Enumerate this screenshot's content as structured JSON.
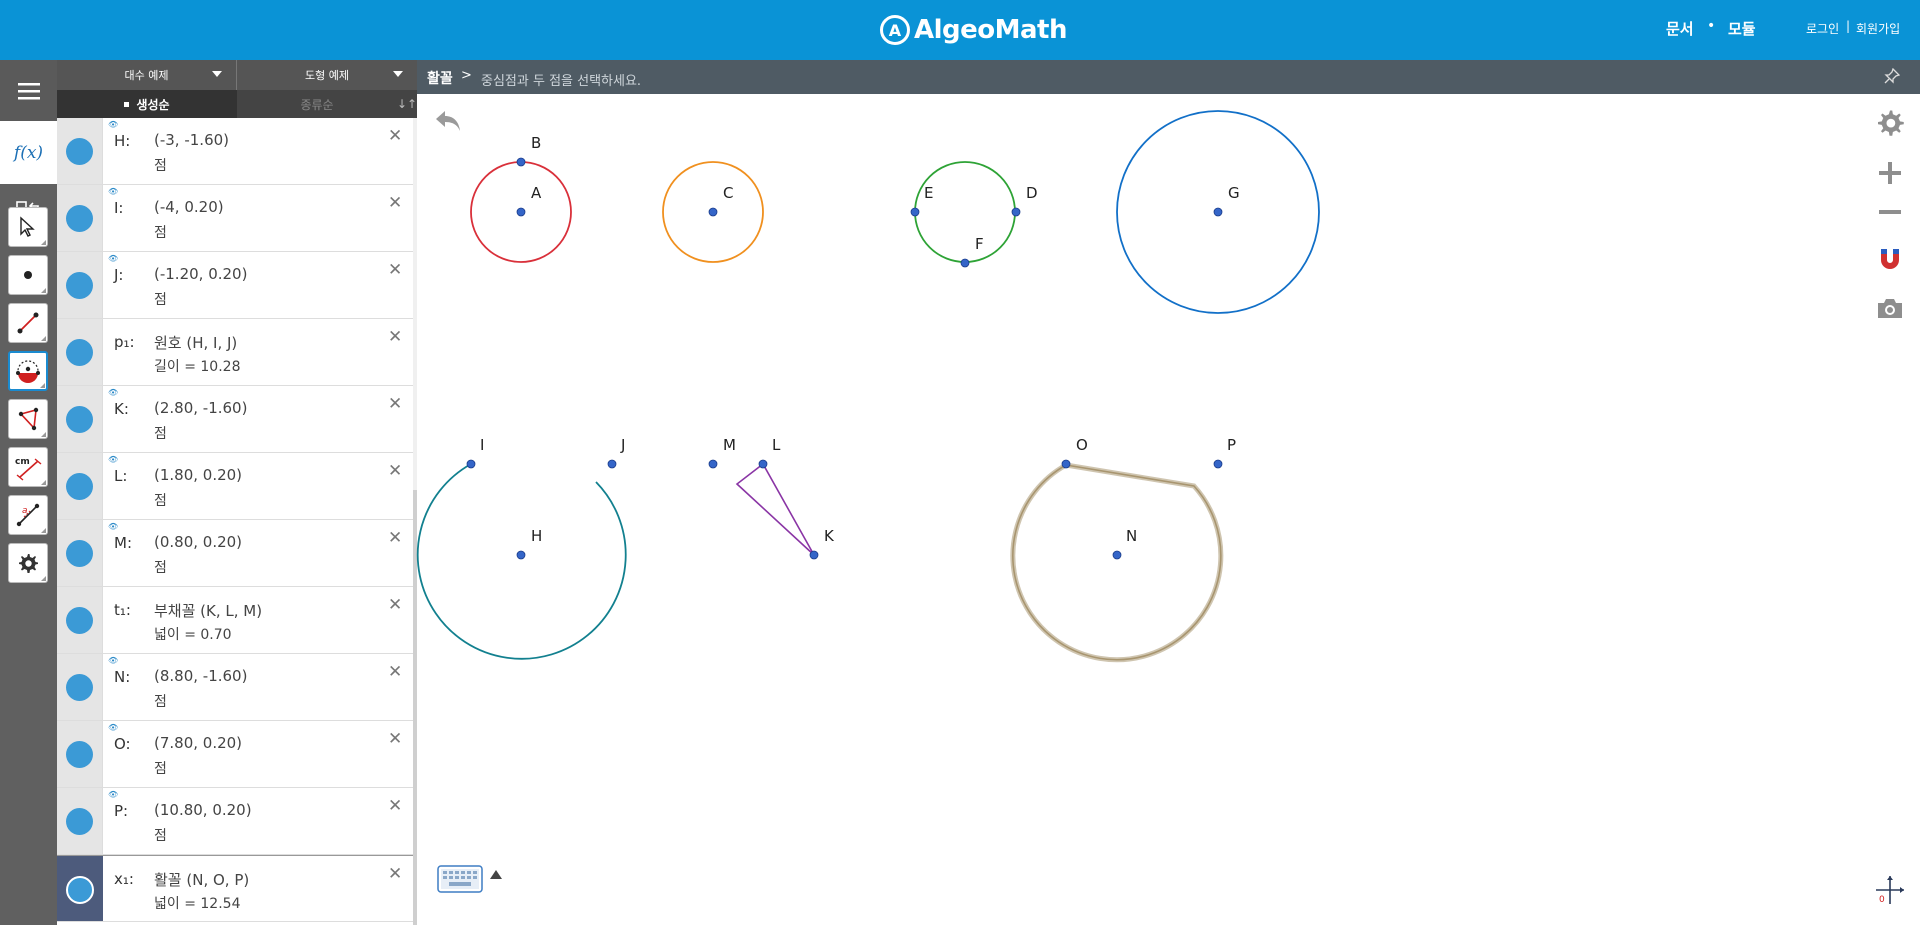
{
  "header": {
    "logo_text": "AlgeoMath",
    "nav_docs": "문서",
    "nav_dot": "•",
    "nav_modules": "모듈",
    "login": "로그인",
    "sep": "|",
    "signup": "회원가입"
  },
  "algebra": {
    "algebra_examples": "대수 예제",
    "geometry_examples": "도형 예제",
    "sort_created": "생성순",
    "sort_type": "종류순",
    "sort_icon": "↓↑",
    "items": [
      {
        "name": "H:",
        "value": "(-3, -1.60)",
        "desc": "점",
        "eye": true
      },
      {
        "name": "I:",
        "value": "(-4, 0.20)",
        "desc": "점",
        "eye": true
      },
      {
        "name": "J:",
        "value": "(-1.20, 0.20)",
        "desc": "점",
        "eye": true
      },
      {
        "name": "p₁:",
        "value": "원호 (H, I, J)",
        "desc": "길이 = 10.28",
        "eye": false
      },
      {
        "name": "K:",
        "value": "(2.80, -1.60)",
        "desc": "점",
        "eye": true
      },
      {
        "name": "L:",
        "value": "(1.80, 0.20)",
        "desc": "점",
        "eye": true
      },
      {
        "name": "M:",
        "value": "(0.80, 0.20)",
        "desc": "점",
        "eye": true
      },
      {
        "name": "t₁:",
        "value": "부채꼴 (K, L, M)",
        "desc": "넓이 = 0.70",
        "eye": false
      },
      {
        "name": "N:",
        "value": "(8.80, -1.60)",
        "desc": "점",
        "eye": true
      },
      {
        "name": "O:",
        "value": "(7.80, 0.20)",
        "desc": "점",
        "eye": true
      },
      {
        "name": "P:",
        "value": "(10.80, 0.20)",
        "desc": "점",
        "eye": true
      },
      {
        "name": "x₁:",
        "value": "활꼴 (N, O, P)",
        "desc": "넓이 = 12.54",
        "eye": false
      }
    ]
  },
  "graphics": {
    "tool_name": "활꼴",
    "arrow": ">",
    "hint": "중심점과 두 점을 선택하세요.",
    "point_labels": {
      "A": "A",
      "B": "B",
      "C": "C",
      "D": "D",
      "E": "E",
      "F": "F",
      "G": "G",
      "H": "H",
      "I": "I",
      "J": "J",
      "K": "K",
      "L": "L",
      "M": "M",
      "N": "N",
      "O": "O",
      "P": "P"
    },
    "colors": {
      "circle_A": "#d9303a",
      "circle_C": "#f0901f",
      "circle_EDF": "#2ea336",
      "circle_G": "#1270c8",
      "arc_HIJ": "#12808f",
      "sector_KLM": "#8a35a5",
      "segment_NOP": "#a8956f",
      "point": "#3465c8"
    }
  },
  "toolbar": {
    "fx_label": "f(x)",
    "tools": [
      "select-tool",
      "point-tool",
      "segment-tool",
      "circle-tool",
      "polygon-tool",
      "measure-tool",
      "transform-tool",
      "settings-tool"
    ],
    "measure_label": "cm"
  }
}
